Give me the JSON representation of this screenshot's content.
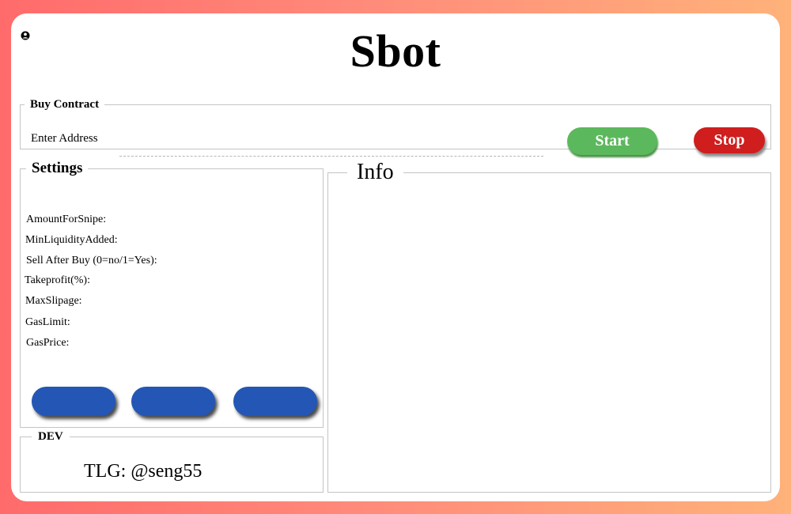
{
  "app": {
    "title": "Sbot"
  },
  "buy_contract": {
    "legend": "Buy Contract",
    "address_label": "Enter Address",
    "address_value": "",
    "start_label": "Start",
    "stop_label": "Stop"
  },
  "settings": {
    "legend": "Settings",
    "items": [
      "AmountForSnipe:",
      "MinLiquidityAdded:",
      "Sell After Buy (0=no/1=Yes):",
      "Takeprofit(%):",
      "MaxSlipage:",
      "GasLimit:",
      "GasPrice:"
    ],
    "buttons": [
      "",
      "",
      ""
    ]
  },
  "dev": {
    "legend": "DEV",
    "contact": "TLG: @seng55"
  },
  "info": {
    "legend": "Info"
  },
  "colors": {
    "start": "#5cb85c",
    "stop": "#d01d1d",
    "action_buttons": "#2456b5",
    "frame_border": "#c4c4c4"
  },
  "icons": {
    "account": "user-circle-icon"
  }
}
